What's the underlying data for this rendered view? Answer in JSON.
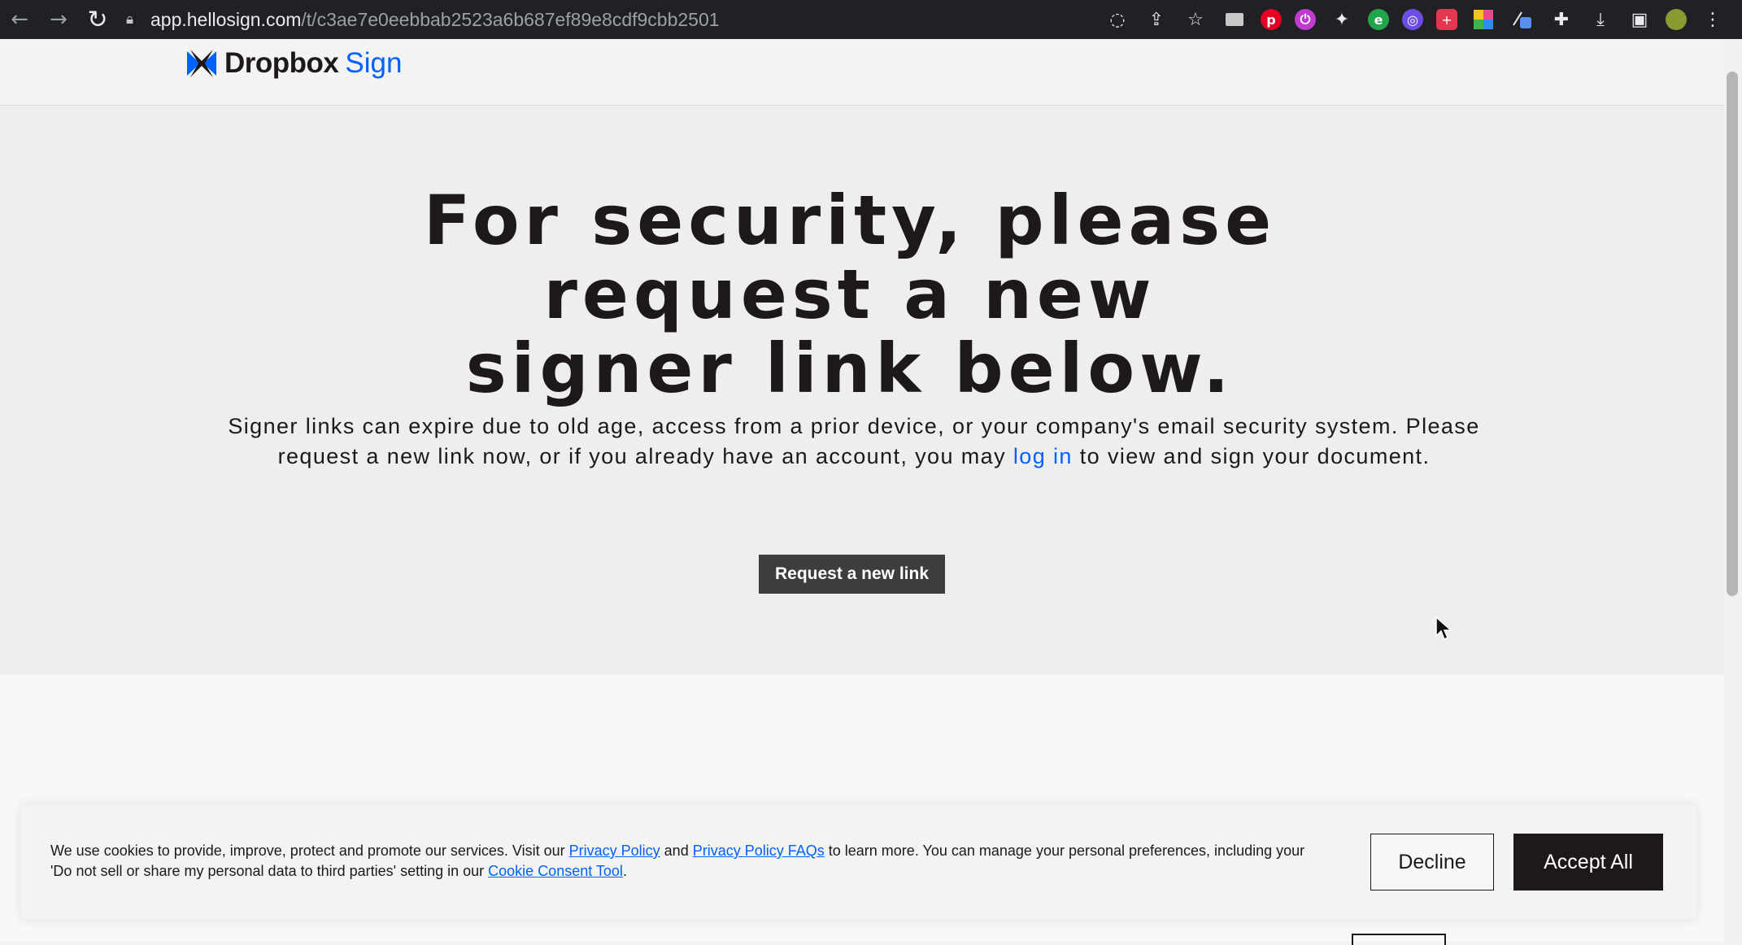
{
  "browser": {
    "url_host": "app.hellosign.com",
    "url_path": "/t/c3ae7e0eebbab2523a6b687ef89e8cdf9cbb2501"
  },
  "header": {
    "logo_primary": "Dropbox",
    "logo_secondary": "Sign"
  },
  "hero": {
    "title": "For security, please request a new signer link below.",
    "subtitle_part1": "Signer links can expire due to old age, access from a prior device, or your company's email security system. Please request a new link now, or if you already have an account, you may ",
    "login_link": "log in",
    "subtitle_part2": " to view and sign your document.",
    "request_button": "Request a new link"
  },
  "cookie_banner": {
    "text_part1": "We use cookies to provide, improve, protect and promote our services. Visit our ",
    "privacy_link": "Privacy Policy",
    "text_and": " and ",
    "faq_link": "Privacy Policy FAQs",
    "text_part2": " to learn more. You can manage your personal preferences, including your 'Do not sell or share my personal data to third parties' setting in our ",
    "consent_link": "Cookie Consent Tool",
    "text_end": ".",
    "decline_label": "Decline",
    "accept_label": "Accept All"
  },
  "colors": {
    "brand_blue": "#0061fe",
    "dark": "#1e1919",
    "button_gray": "#3d3d3d"
  }
}
